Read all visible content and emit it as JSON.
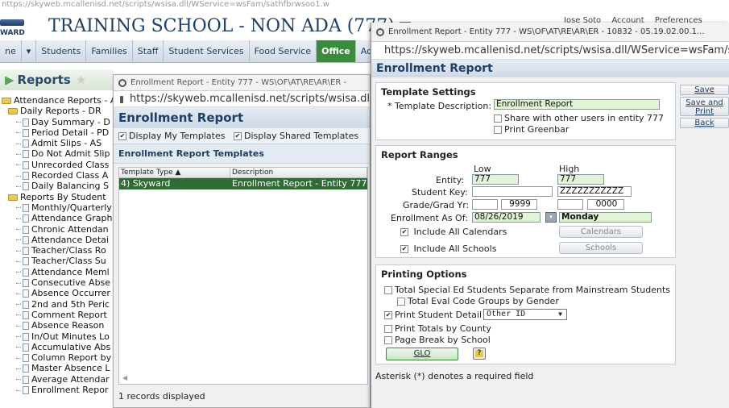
{
  "browser_bg": {
    "url": "nttps://skyweb.mcallenisd.net/scripts/wsisa.dll/WService=wsFam/sathfbrwsoo1.w"
  },
  "header": {
    "logo_text": "WARD",
    "school_name": "TRAINING SCHOOL - NON ADA (777)"
  },
  "nav": {
    "items": [
      "ne",
      "Students",
      "Families",
      "Staff",
      "Student Services",
      "Food Service",
      "Office",
      "Adminis"
    ],
    "active": "Office"
  },
  "reports_header": {
    "title": "Reports"
  },
  "tree": {
    "items": [
      {
        "label": "Attendance Reports - A",
        "level": 0,
        "type": "folder"
      },
      {
        "label": "Daily Reports - DR",
        "level": 1,
        "type": "folder"
      },
      {
        "label": "Day Summary - D",
        "level": 2,
        "type": "doc"
      },
      {
        "label": "Period Detail - PD",
        "level": 2,
        "type": "doc"
      },
      {
        "label": "Admit Slips - AS",
        "level": 2,
        "type": "doc"
      },
      {
        "label": "Do Not Admit Slip",
        "level": 2,
        "type": "doc"
      },
      {
        "label": "Unrecorded Class",
        "level": 2,
        "type": "doc"
      },
      {
        "label": "Recorded Class A",
        "level": 2,
        "type": "doc"
      },
      {
        "label": "Daily Balancing S",
        "level": 2,
        "type": "doc"
      },
      {
        "label": "Reports By Student",
        "level": 1,
        "type": "folder"
      },
      {
        "label": "Monthly/Quarterly",
        "level": 2,
        "type": "doc"
      },
      {
        "label": "Attendance Graph",
        "level": 2,
        "type": "doc"
      },
      {
        "label": "Chronic Attendan",
        "level": 2,
        "type": "doc"
      },
      {
        "label": "Attendance Detai",
        "level": 2,
        "type": "doc"
      },
      {
        "label": "Teacher/Class Ro",
        "level": 2,
        "type": "doc"
      },
      {
        "label": "Teacher/Class Su",
        "level": 2,
        "type": "doc"
      },
      {
        "label": "Attendance Meml",
        "level": 2,
        "type": "doc"
      },
      {
        "label": "Consecutive Abse",
        "level": 2,
        "type": "doc"
      },
      {
        "label": "Absence Occurrer",
        "level": 2,
        "type": "doc"
      },
      {
        "label": "2nd and 5th Peric",
        "level": 2,
        "type": "doc"
      },
      {
        "label": "Comment Report",
        "level": 2,
        "type": "doc"
      },
      {
        "label": "Absence Reason",
        "level": 2,
        "type": "doc"
      },
      {
        "label": "In/Out Minutes Lo",
        "level": 2,
        "type": "doc"
      },
      {
        "label": "Accumulative Abs",
        "level": 2,
        "type": "doc"
      },
      {
        "label": "Column Report by",
        "level": 2,
        "type": "doc"
      },
      {
        "label": "Master Absence L",
        "level": 2,
        "type": "doc"
      },
      {
        "label": "Average Attendar",
        "level": 2,
        "type": "doc"
      },
      {
        "label": "Enrollment Repor",
        "level": 2,
        "type": "doc"
      }
    ]
  },
  "popup1": {
    "tab_title": "Enrollment Report - Entity 777 - WS\\OF\\AT\\RE\\AR\\ER -",
    "url": "https://skyweb.mcallenisd.net/scripts/wsisa.dl",
    "title": "Enrollment Report",
    "display_my_templates": "Display My Templates",
    "display_shared_templates": "Display Shared Templates",
    "templates_header": "Enrollment Report Templates",
    "columns": [
      "Template Type ▲",
      "Description"
    ],
    "rows": [
      [
        "4) Skyward",
        "Enrollment Report - Entity 777"
      ]
    ],
    "records": "1 records displayed"
  },
  "user_bar": {
    "user": "Jose Soto",
    "account": "Account",
    "preferences": "Preferences"
  },
  "popup2": {
    "tab_title": "Enrollment Report - Entity 777 - WS\\OF\\AT\\RE\\AR\\ER - 10832 - 05.19.02.00.1...",
    "url": "https://skyweb.mcallenisd.net/scripts/wsisa.dll/WService=wsFam/s",
    "title": "Enrollment Report",
    "buttons": {
      "save": "Save",
      "save_print": "Save and Print",
      "back": "Back"
    },
    "template_settings": {
      "heading": "Template Settings",
      "desc_label": "* Template Description:",
      "desc_value": "Enrollment Report",
      "share": "Share with other users in entity 777",
      "greenbar": "Print Greenbar"
    },
    "ranges": {
      "heading": "Report Ranges",
      "low": "Low",
      "high": "High",
      "entity_label": "Entity:",
      "entity_low": "777",
      "entity_high": "777",
      "student_key_label": "Student Key:",
      "student_key_low": "",
      "student_key_high": "ZZZZZZZZZZZ",
      "grade_label": "Grade/Grad Yr:",
      "grade_low_year": "9999",
      "grade_high_year": "0000",
      "enroll_label": "Enrollment As Of:",
      "enroll_date": "08/26/2019",
      "enroll_day": "Monday",
      "include_calendars": "Include All Calendars",
      "calendars_btn": "Calendars",
      "include_schools": "Include All Schools",
      "schools_btn": "Schools"
    },
    "printing": {
      "heading": "Printing Options",
      "sped": "Total Special Ed Students Separate from Mainstream Students",
      "eval_code": "Total Eval Code Groups by Gender",
      "print_detail": "Print Student Detail",
      "detail_select": "Other ID",
      "totals_county": "Print Totals by County",
      "page_break": "Page Break by School",
      "glo": "GLO"
    },
    "footnote": "Asterisk (*) denotes a required field"
  }
}
